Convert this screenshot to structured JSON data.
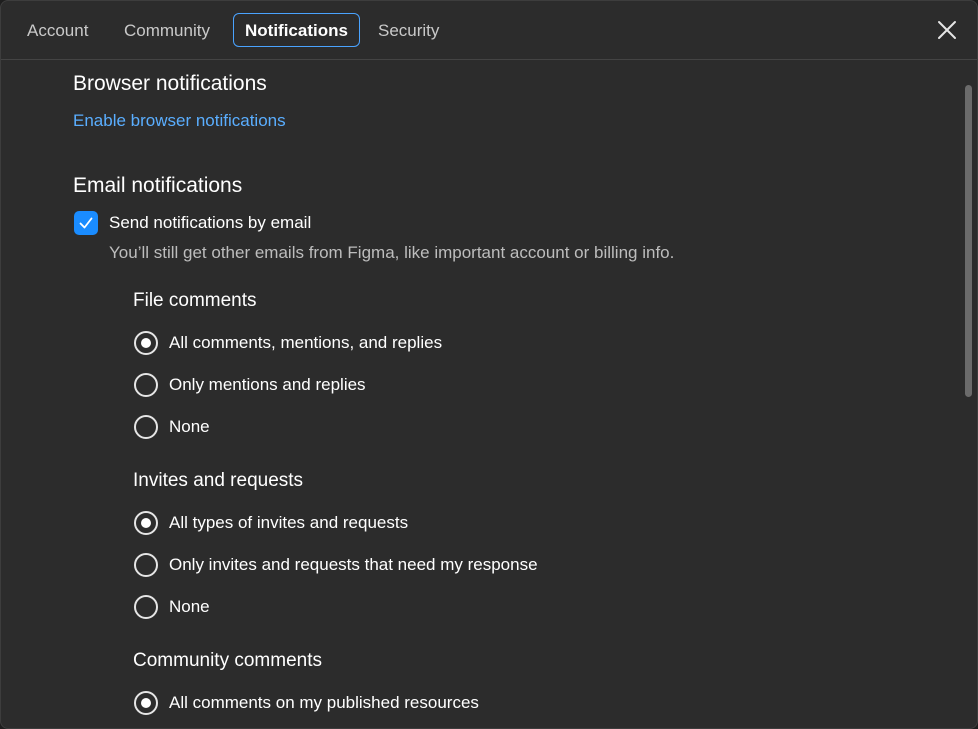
{
  "tabs": [
    {
      "label": "Account"
    },
    {
      "label": "Community"
    },
    {
      "label": "Notifications"
    },
    {
      "label": "Security"
    }
  ],
  "browser": {
    "heading": "Browser notifications",
    "link": "Enable browser notifications"
  },
  "email": {
    "heading": "Email notifications",
    "checkbox_label": "Send notifications by email",
    "checkbox_checked": true,
    "hint": "You’ll still get other emails from Figma, like important account or billing info."
  },
  "file_comments": {
    "heading": "File comments",
    "options": [
      {
        "label": "All comments, mentions, and replies",
        "selected": true
      },
      {
        "label": "Only mentions and replies",
        "selected": false
      },
      {
        "label": "None",
        "selected": false
      }
    ]
  },
  "invites": {
    "heading": "Invites and requests",
    "options": [
      {
        "label": "All types of invites and requests",
        "selected": true
      },
      {
        "label": "Only invites and requests that need my response",
        "selected": false
      },
      {
        "label": "None",
        "selected": false
      }
    ]
  },
  "community_comments": {
    "heading": "Community comments",
    "options": [
      {
        "label": "All comments on my published resources",
        "selected": true
      }
    ]
  },
  "colors": {
    "accent": "#1a8cff",
    "link": "#5aaeff",
    "background": "#2c2c2c"
  }
}
